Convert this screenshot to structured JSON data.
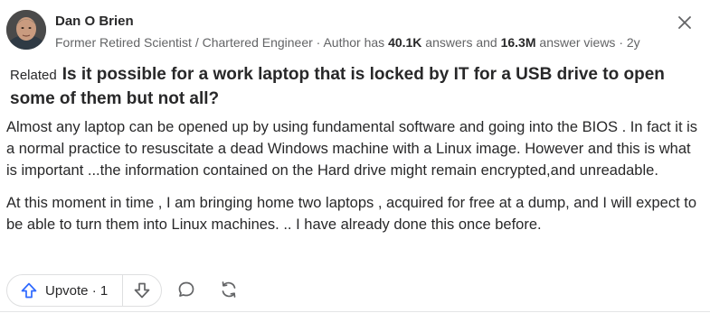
{
  "author": {
    "name": "Dan O Brien",
    "credential_prefix": "Former Retired Scientist / Chartered Engineer · Author has ",
    "answers_count": "40.1K",
    "answers_mid": " answers and ",
    "views_count": "16.3M",
    "views_suffix": " answer views · 2y"
  },
  "question": {
    "related_label": "Related",
    "title": "Is it possible for a work laptop that is locked by IT for a USB drive to open some of them but not all?"
  },
  "answer": {
    "paragraphs": [
      "Almost any laptop can be opened up by using fundamental software and going into the BIOS . In fact it is a normal practice to resuscitate a dead Windows machine with a Linux image. However and this is what is important ...the information contained on the Hard drive might remain encrypted,and unreadable.",
      "At this moment in time , I am bringing home two laptops , acquired for free at a dump, and I will expect to be able to turn them into Linux machines. .. I have already done this once before."
    ]
  },
  "actions": {
    "upvote_label": "Upvote · 1",
    "icons": [
      "upvote-arrow-icon",
      "downvote-arrow-icon",
      "comment-icon",
      "share-icon",
      "close-icon"
    ]
  },
  "colors": {
    "primary_text": "#282829",
    "secondary_text": "#636466",
    "upvote_blue": "#2e69ff",
    "border": "#dedfe0"
  }
}
